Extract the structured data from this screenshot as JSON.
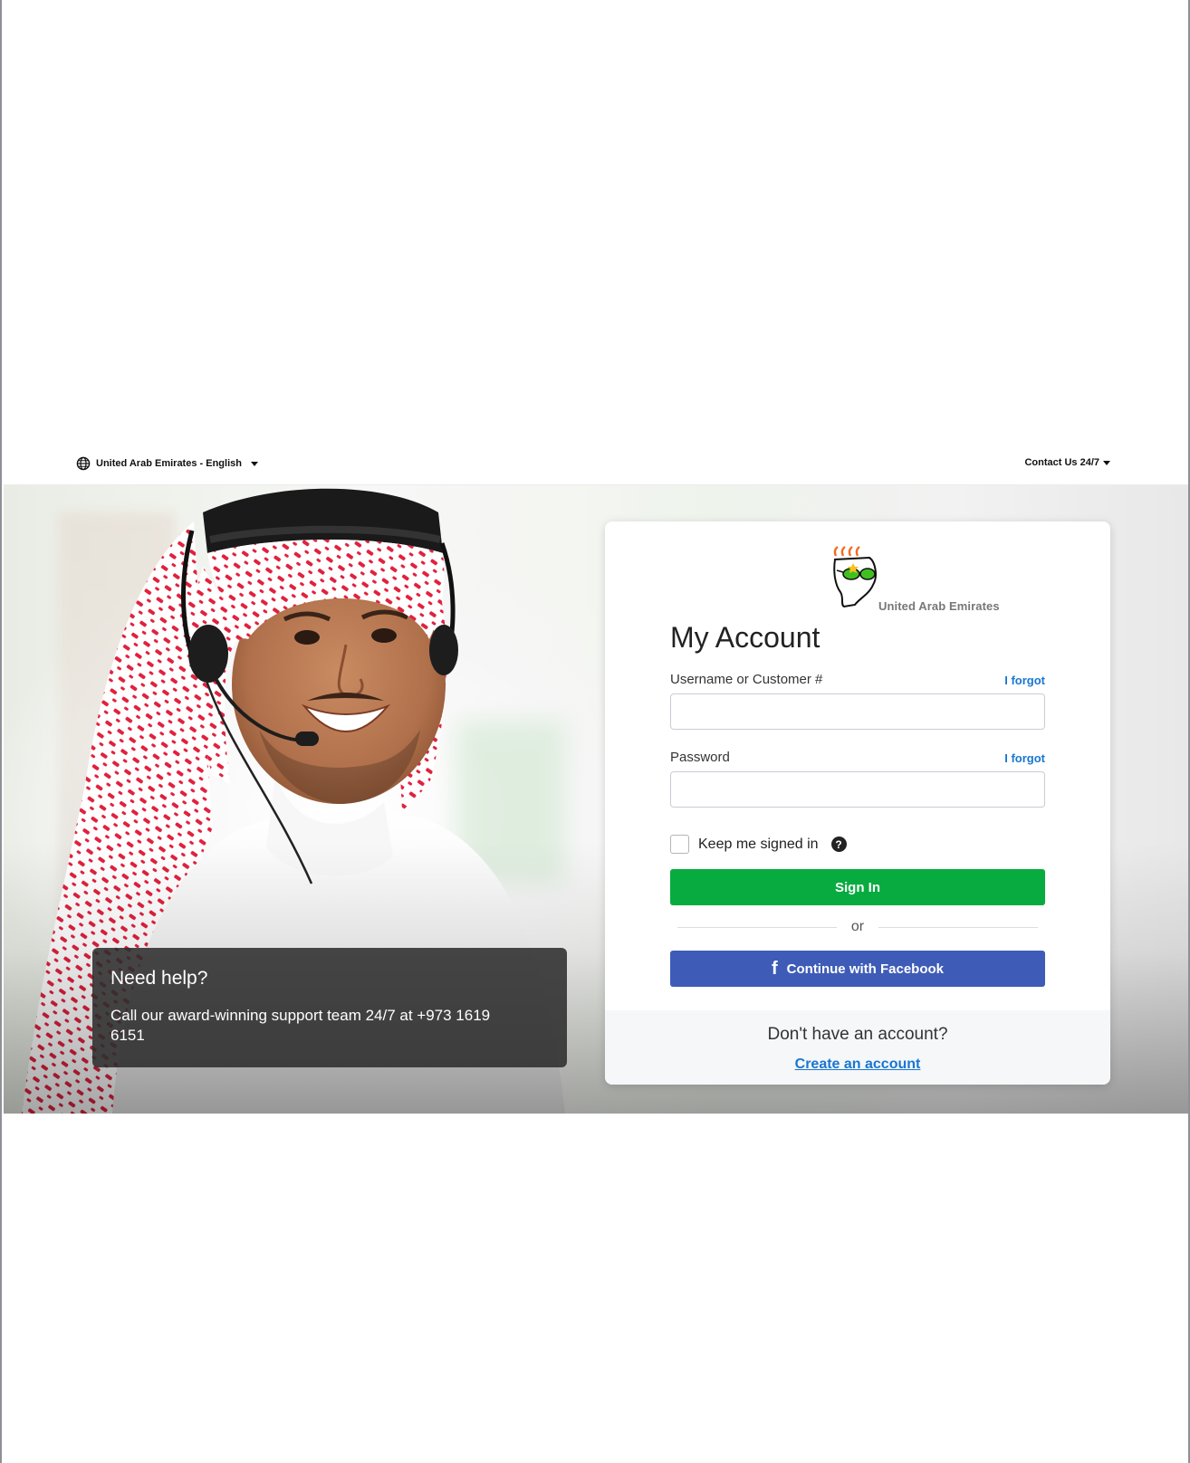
{
  "topbar": {
    "locale_label": "United Arab Emirates - English",
    "contact_label": "Contact Us 24/7"
  },
  "help": {
    "title": "Need help?",
    "text": "Call our award-winning support team 24/7 at +973 1619 6151"
  },
  "login": {
    "logo_region": "United Arab Emirates",
    "title": "My Account",
    "username_label": "Username or Customer #",
    "username_value": "",
    "password_label": "Password",
    "password_value": "",
    "forgot_label": "I forgot",
    "keep_signed_in_label": "Keep me signed in",
    "help_icon_glyph": "?",
    "sign_in_label": "Sign In",
    "or_label": "or",
    "facebook_label": "Continue with Facebook",
    "facebook_glyph": "f",
    "no_account_text": "Don't have an account?",
    "create_account_label": "Create an account"
  },
  "colors": {
    "sign_in": "#08ab3f",
    "facebook": "#3e5cb7",
    "link": "#1976d2"
  },
  "icons": {
    "locale": "globe-icon",
    "dropdown": "caret-down-icon",
    "help": "question-circle-icon",
    "facebook": "facebook-icon",
    "logo": "go-daddy-guy-logo-icon"
  }
}
